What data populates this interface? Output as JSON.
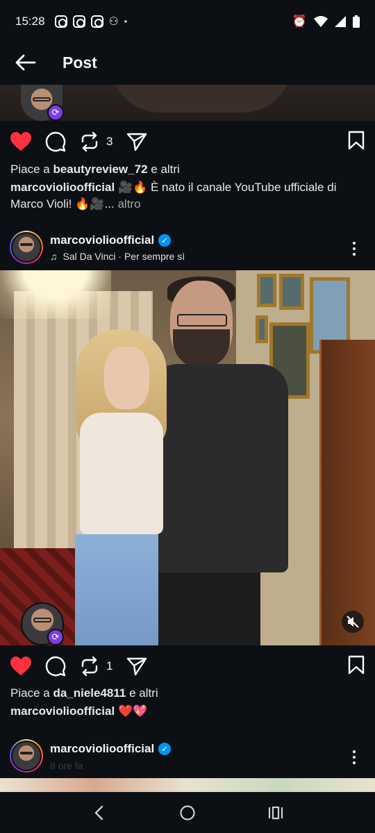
{
  "status": {
    "time": "15:28"
  },
  "header": {
    "title": "Post"
  },
  "post1": {
    "repost_count": "3",
    "likes_prefix": "Piace a",
    "likes_user": "beautyreview_72",
    "likes_suffix": "e altri",
    "caption_user": "marcoviolioofficial",
    "caption_text": "🎥🔥 È nato il canale YouTube ufficiale di Marco Violi! 🔥🎥...",
    "more_label": "altro"
  },
  "post2": {
    "username": "marcoviolioofficial",
    "music": "Sal Da Vinci · Per sempre sì",
    "repost_count": "1",
    "likes_prefix": "Piace a",
    "likes_user": "da_niele4811",
    "likes_suffix": "e altri",
    "caption_user": "marcoviolioofficial",
    "caption_text": "❤️💖"
  },
  "post3": {
    "username": "marcoviolioofficial",
    "time_ago": "8 ore fa"
  },
  "icons": {
    "back": "arrow-left-icon",
    "like": "heart-icon",
    "comment": "comment-icon",
    "repost": "repost-icon",
    "share": "send-icon",
    "save": "bookmark-icon",
    "more": "kebab-icon",
    "verified": "verified-badge-icon",
    "music": "music-note-icon",
    "mute": "muted-speaker-icon"
  },
  "colors": {
    "like": "#ff3040",
    "verified": "#0095f6",
    "background": "#0c1014"
  }
}
